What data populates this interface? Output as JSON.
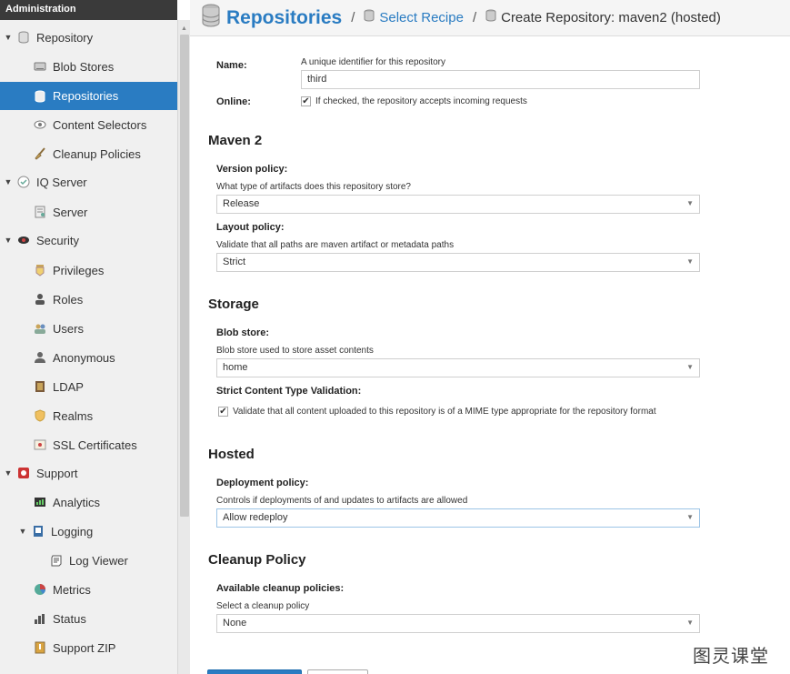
{
  "sidebar": {
    "header": "Administration",
    "repository": "Repository",
    "blob_stores": "Blob Stores",
    "repositories": "Repositories",
    "content_selectors": "Content Selectors",
    "cleanup_policies": "Cleanup Policies",
    "iq_server": "IQ Server",
    "server": "Server",
    "security": "Security",
    "privileges": "Privileges",
    "roles": "Roles",
    "users": "Users",
    "anonymous": "Anonymous",
    "ldap": "LDAP",
    "realms": "Realms",
    "ssl_certificates": "SSL Certificates",
    "support": "Support",
    "analytics": "Analytics",
    "logging": "Logging",
    "log_viewer": "Log Viewer",
    "metrics": "Metrics",
    "status": "Status",
    "support_zip": "Support ZIP"
  },
  "breadcrumb": {
    "main": "Repositories",
    "sep": "/",
    "select_recipe": "Select Recipe",
    "current": "Create Repository: maven2 (hosted)"
  },
  "form": {
    "name_label": "Name:",
    "name_help": "A unique identifier for this repository",
    "name_value": "third",
    "online_label": "Online:",
    "online_help": "If checked, the repository accepts incoming requests",
    "maven_title": "Maven 2",
    "version_label": "Version policy:",
    "version_help": "What type of artifacts does this repository store?",
    "version_value": "Release",
    "layout_label": "Layout policy:",
    "layout_help": "Validate that all paths are maven artifact or metadata paths",
    "layout_value": "Strict",
    "storage_title": "Storage",
    "blob_label": "Blob store:",
    "blob_help": "Blob store used to store asset contents",
    "blob_value": "home",
    "strict_label": "Strict Content Type Validation:",
    "strict_help": "Validate that all content uploaded to this repository is of a MIME type appropriate for the repository format",
    "hosted_title": "Hosted",
    "deploy_label": "Deployment policy:",
    "deploy_help": "Controls if deployments of and updates to artifacts are allowed",
    "deploy_value": "Allow redeploy",
    "cleanup_title": "Cleanup Policy",
    "cleanup_label": "Available cleanup policies:",
    "cleanup_help": "Select a cleanup policy",
    "cleanup_value": "None"
  },
  "glyphs": {
    "check": "✔",
    "caret_down": "▼",
    "scroll_up": "▲"
  },
  "watermark": "图灵课堂",
  "colors": {
    "accent": "#2a7cc2",
    "sidebar_bg": "#f0f0f0",
    "sidebar_header": "#3a3a3a"
  }
}
